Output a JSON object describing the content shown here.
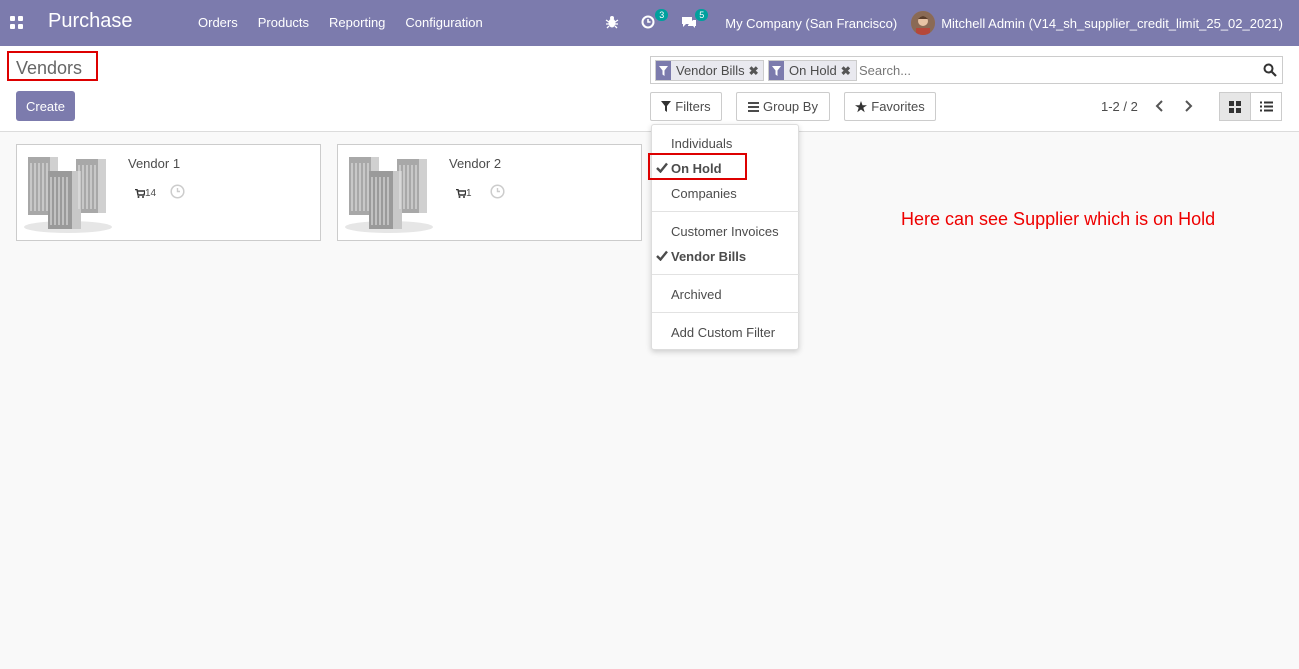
{
  "navbar": {
    "app_name": "Purchase",
    "menu": [
      "Orders",
      "Products",
      "Reporting",
      "Configuration"
    ],
    "activity_count": "3",
    "message_count": "5",
    "company": "My Company (San Francisco)",
    "user": "Mitchell Admin (V14_sh_supplier_credit_limit_25_02_2021)"
  },
  "control_panel": {
    "breadcrumb": "Vendors",
    "create_label": "Create",
    "facets": [
      "Vendor Bills",
      "On Hold"
    ],
    "search_placeholder": "Search...",
    "filters_label": "Filters",
    "groupby_label": "Group By",
    "favorites_label": "Favorites",
    "pager": "1-2 / 2"
  },
  "vendors": [
    {
      "name": "Vendor 1",
      "po_count": "14"
    },
    {
      "name": "Vendor 2",
      "po_count": "1"
    }
  ],
  "filters_menu": {
    "groups": [
      [
        {
          "label": "Individuals",
          "checked": false
        },
        {
          "label": "On Hold",
          "checked": true
        },
        {
          "label": "Companies",
          "checked": false
        }
      ],
      [
        {
          "label": "Customer Invoices",
          "checked": false
        },
        {
          "label": "Vendor Bills",
          "checked": true
        }
      ],
      [
        {
          "label": "Archived",
          "checked": false
        }
      ],
      [
        {
          "label": "Add Custom Filter",
          "checked": false
        }
      ]
    ]
  },
  "annotation": "Here can see Supplier which is on Hold",
  "colors": {
    "primary": "#7c7bad",
    "badge": "#00a09d",
    "highlight": "#dd0000"
  }
}
